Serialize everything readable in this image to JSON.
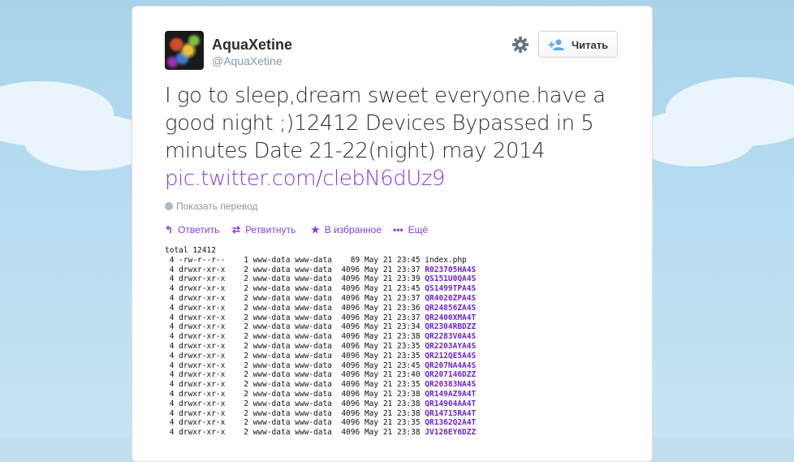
{
  "author": {
    "name": "AquaXetine",
    "handle": "@AquaXetine"
  },
  "follow_label": "Читать",
  "tweet": {
    "text": "I go to sleep,dream sweet everyone.have a good night ;)12412 Devices Bypassed in 5 minutes Date 21-22(night) may 2014",
    "link": "pic.twitter.com/clebN6dUz9"
  },
  "translate_label": "Показать перевод",
  "actions": [
    {
      "label": "Ответить",
      "icon": "reply-icon"
    },
    {
      "label": "Ретвитнуть",
      "icon": "retweet-icon"
    },
    {
      "label": "В избранное",
      "icon": "star-icon"
    },
    {
      "label": "Ещё",
      "icon": "more-icon"
    }
  ],
  "colors": {
    "link": "#8b3dd9",
    "dir": "#6b24d9"
  },
  "terminal": {
    "total": "total 12412",
    "rows": [
      {
        "meta": " 4 -rw-r--r--    1 www-data www-data    89 May 21 23:45 ",
        "name": "index.php",
        "dir": false
      },
      {
        "meta": " 4 drwxr-xr-x    2 www-data www-data  4096 May 21 23:37 ",
        "name": "R023705HA4S",
        "dir": true
      },
      {
        "meta": " 4 drwxr-xr-x    2 www-data www-data  4096 May 21 23:39 ",
        "name": "QS151U0QA4S",
        "dir": true
      },
      {
        "meta": " 4 drwxr-xr-x    2 www-data www-data  4096 May 21 23:45 ",
        "name": "QS1499TPA4S",
        "dir": true
      },
      {
        "meta": " 4 drwxr-xr-x    2 www-data www-data  4096 May 21 23:37 ",
        "name": "QR4020ZPA4S",
        "dir": true
      },
      {
        "meta": " 4 drwxr-xr-x    2 www-data www-data  4096 May 21 23:36 ",
        "name": "QR24856ZA4S",
        "dir": true
      },
      {
        "meta": " 4 drwxr-xr-x    2 www-data www-data  4096 May 21 23:37 ",
        "name": "QR2400XMA4T",
        "dir": true
      },
      {
        "meta": " 4 drwxr-xr-x    2 www-data www-data  4096 May 21 23:34 ",
        "name": "QR2304RBDZZ",
        "dir": true
      },
      {
        "meta": " 4 drwxr-xr-x    2 www-data www-data  4096 May 21 23:38 ",
        "name": "QR2283V0A4S",
        "dir": true
      },
      {
        "meta": " 4 drwxr-xr-x    2 www-data www-data  4096 May 21 23:35 ",
        "name": "QR2203AYA4S",
        "dir": true
      },
      {
        "meta": " 4 drwxr-xr-x    2 www-data www-data  4096 May 21 23:35 ",
        "name": "QR212QE5A4S",
        "dir": true
      },
      {
        "meta": " 4 drwxr-xr-x    2 www-data www-data  4096 May 21 23:45 ",
        "name": "QR207NA4A4S",
        "dir": true
      },
      {
        "meta": " 4 drwxr-xr-x    2 www-data www-data  4096 May 21 23:40 ",
        "name": "QR207146DZZ",
        "dir": true
      },
      {
        "meta": " 4 drwxr-xr-x    2 www-data www-data  4096 May 21 23:35 ",
        "name": "QR20383NA4S",
        "dir": true
      },
      {
        "meta": " 4 drwxr-xr-x    2 www-data www-data  4096 May 21 23:38 ",
        "name": "QR149AZ9A4T",
        "dir": true
      },
      {
        "meta": " 4 drwxr-xr-x    2 www-data www-data  4096 May 21 23:38 ",
        "name": "QR14904AA4T",
        "dir": true
      },
      {
        "meta": " 4 drwxr-xr-x    2 www-data www-data  4096 May 21 23:38 ",
        "name": "QR14715RA4T",
        "dir": true
      },
      {
        "meta": " 4 drwxr-xr-x    2 www-data www-data  4096 May 21 23:35 ",
        "name": "QR1362Q2A4T",
        "dir": true
      },
      {
        "meta": " 4 drwxr-xr-x    2 www-data www-data  4096 May 21 23:38 ",
        "name": "JV126EY6DZZ",
        "dir": true
      }
    ]
  }
}
